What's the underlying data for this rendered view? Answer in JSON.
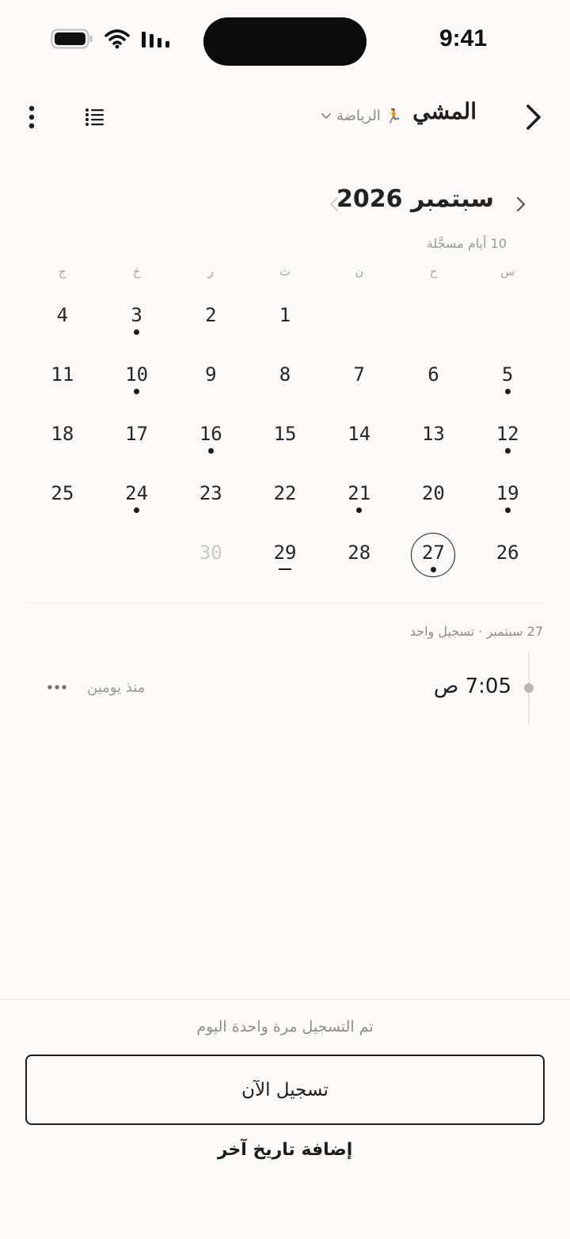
{
  "status_bar": {
    "time": "9:41"
  },
  "header": {
    "title": "المشي",
    "category_label": "الرياضة",
    "category_emoji": "🏃"
  },
  "calendar": {
    "month_title": "سبتمبر 2026",
    "logged_count": "10 أيام مسجَّلة",
    "weekdays": [
      "س",
      "ح",
      "ن",
      "ث",
      "ر",
      "خ",
      "ج"
    ],
    "days": [
      {
        "n": "",
        "empty": true
      },
      {
        "n": "",
        "empty": true
      },
      {
        "n": "",
        "empty": true
      },
      {
        "n": "1"
      },
      {
        "n": "2"
      },
      {
        "n": "3",
        "dot": true
      },
      {
        "n": "4"
      },
      {
        "n": "5",
        "dot": true
      },
      {
        "n": "6"
      },
      {
        "n": "7"
      },
      {
        "n": "8"
      },
      {
        "n": "9"
      },
      {
        "n": "10",
        "dot": true
      },
      {
        "n": "11"
      },
      {
        "n": "12",
        "dot": true
      },
      {
        "n": "13"
      },
      {
        "n": "14"
      },
      {
        "n": "15"
      },
      {
        "n": "16",
        "dot": true
      },
      {
        "n": "17"
      },
      {
        "n": "18"
      },
      {
        "n": "19",
        "dot": true
      },
      {
        "n": "20"
      },
      {
        "n": "21",
        "dot": true
      },
      {
        "n": "22"
      },
      {
        "n": "23"
      },
      {
        "n": "24",
        "dot": true
      },
      {
        "n": "25"
      },
      {
        "n": "26"
      },
      {
        "n": "27",
        "dot": true,
        "selected": true
      },
      {
        "n": "28"
      },
      {
        "n": "29",
        "today": true
      },
      {
        "n": "30",
        "faded": true
      }
    ]
  },
  "selected_day": {
    "summary": "27 سبتمبر · تسجيل واحد",
    "entries": [
      {
        "time": "7:05 ص",
        "ago": "منذ يومين"
      }
    ]
  },
  "footer": {
    "logged_today": "تم التسجيل مرة واحدة اليوم",
    "log_now_label": "تسجيل الآن",
    "add_date_label": "إضافة تاريخ آخر"
  },
  "colors": {
    "background": "#faf9f7",
    "text": "#1c1c1c",
    "muted": "#8e8d89"
  },
  "icons": [
    "battery-icon",
    "wifi-icon",
    "cellular-signal-icon",
    "back-chevron-icon",
    "list-icon",
    "more-vertical-icon",
    "chevron-down-icon",
    "month-prev-icon",
    "month-next-icon",
    "more-horizontal-icon"
  ]
}
